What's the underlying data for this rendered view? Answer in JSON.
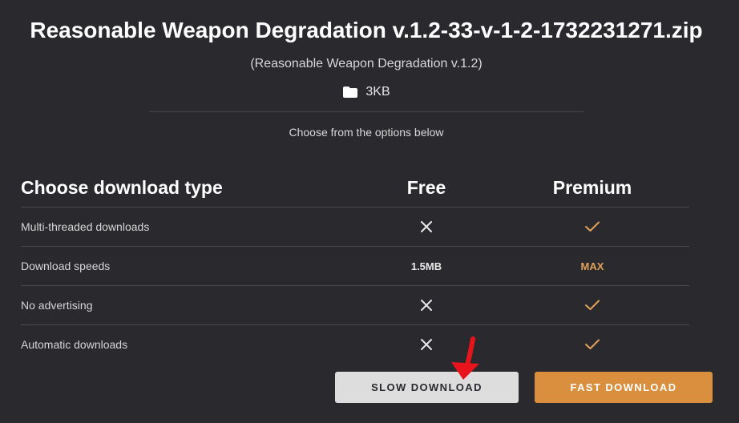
{
  "file": {
    "title": "Reasonable Weapon Degradation v.1.2-33-v-1-2-1732231271.zip",
    "subtitle": "(Reasonable Weapon Degradation v.1.2)",
    "size": "3KB",
    "size_icon": "folder-icon"
  },
  "options_hint": "Choose from the options below",
  "table": {
    "header": {
      "feature": "Choose download type",
      "free": "Free",
      "premium": "Premium"
    },
    "rows": [
      {
        "feature": "Multi-threaded downloads",
        "free": "x-icon",
        "premium": "check-icon"
      },
      {
        "feature": "Download speeds",
        "free": "1.5MB",
        "premium": "MAX"
      },
      {
        "feature": "No advertising",
        "free": "x-icon",
        "premium": "check-icon"
      },
      {
        "feature": "Automatic downloads",
        "free": "x-icon",
        "premium": "check-icon"
      }
    ]
  },
  "buttons": {
    "slow": "SLOW DOWNLOAD",
    "fast": "FAST DOWNLOAD"
  },
  "colors": {
    "background": "#2a292e",
    "accent": "#d98f3e",
    "check": "#e0a25a",
    "annotation_arrow": "#e8141b"
  }
}
